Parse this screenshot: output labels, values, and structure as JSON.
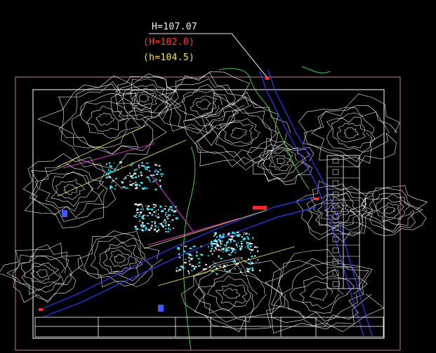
{
  "callouts": {
    "h1": {
      "text": "H=107.07",
      "color": "#f2f2f2"
    },
    "h2": {
      "text": "(H=102.0)",
      "color": "#ff3b3b"
    },
    "h3": {
      "text": "(h=104.5)",
      "color": "#f4e04a"
    }
  },
  "drawing": {
    "colors": {
      "background": "#000000",
      "outer_frame": "#c77b8a",
      "inner_frame": "#ffffff",
      "contours": "#f2f2f2",
      "road": "#2b3cff",
      "boundary_green": "#3bd13b",
      "yellow": "#e8e04a",
      "magenta": "#ff3cf0",
      "red": "#ff2a2a",
      "cyan": "#28e6ff"
    }
  }
}
